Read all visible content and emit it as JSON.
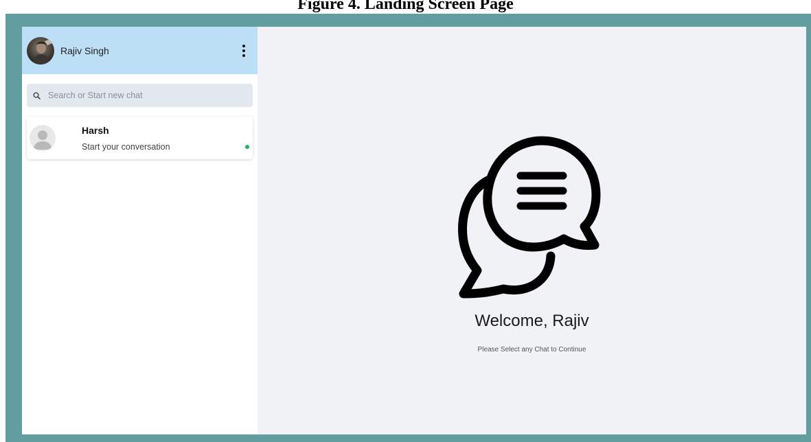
{
  "caption": "Figure 4. Landing Screen Page",
  "colors": {
    "frame": "#629e9f",
    "header": "#bcdff5",
    "main_background": "#f0f2f6",
    "search_background": "#e3e8ef",
    "online": "#1fb45a"
  },
  "sidebar": {
    "user": {
      "name": "Rajiv Singh",
      "avatar": "user-photo"
    },
    "menu_icon": "vertical-dots-icon",
    "search": {
      "placeholder": "Search or Start new chat",
      "value": "",
      "icon": "search-icon"
    },
    "chats": [
      {
        "name": "Harsh",
        "last_message": "Start your conversation",
        "online": true,
        "avatar": "default-user-icon"
      }
    ]
  },
  "main": {
    "illustration": "chat-bubbles-icon",
    "welcome_title": "Welcome, Rajiv",
    "welcome_subtitle": "Please Select any Chat to Continue"
  }
}
